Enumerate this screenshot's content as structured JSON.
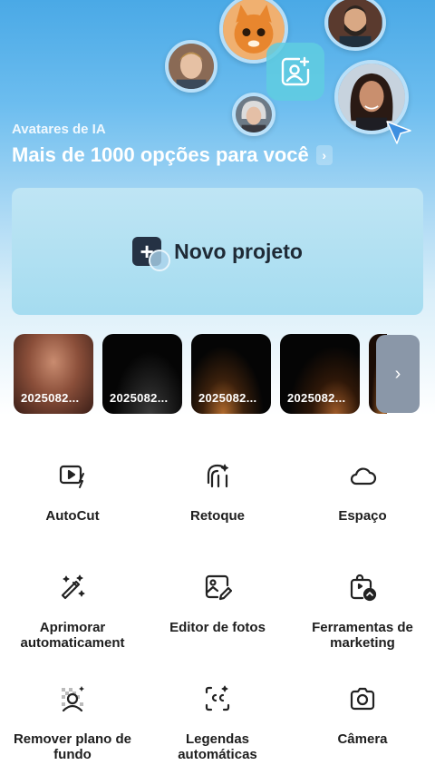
{
  "hero": {
    "subtitle": "Avatares de IA",
    "title": "Mais de 1000 opções para você",
    "chevron": "›",
    "avatars": [
      "cat-avatar",
      "man-avatar",
      "bearded-man-avatar",
      "old-woman-avatar",
      "woman-avatar"
    ],
    "badge_icon": "ai-avatar-icon"
  },
  "new_project": {
    "label": "Novo projeto",
    "plus": "+"
  },
  "recents": {
    "items": [
      {
        "caption": "2025082..."
      },
      {
        "caption": "2025082..."
      },
      {
        "caption": "2025082..."
      },
      {
        "caption": "2025082..."
      }
    ],
    "more": "›"
  },
  "tools": [
    {
      "label": "AutoCut",
      "icon": "autocut-icon"
    },
    {
      "label": "Retoque",
      "icon": "retouch-icon"
    },
    {
      "label": "Espaço",
      "icon": "cloud-icon"
    },
    {
      "label": "Aprimorar automaticament",
      "icon": "magic-wand-icon"
    },
    {
      "label": "Editor de fotos",
      "icon": "photo-editor-icon"
    },
    {
      "label": "Ferramentas de marketing",
      "icon": "marketing-icon"
    },
    {
      "label": "Remover plano de fundo",
      "icon": "remove-background-icon"
    },
    {
      "label": "Legendas automáticas",
      "icon": "captions-icon"
    },
    {
      "label": "Câmera",
      "icon": "camera-icon"
    }
  ],
  "colors": {
    "hero_top": "#4aa9e6",
    "card_bg": "#a5dcf0",
    "plus_bg": "#253244",
    "more_bg": "#8a97a8"
  }
}
